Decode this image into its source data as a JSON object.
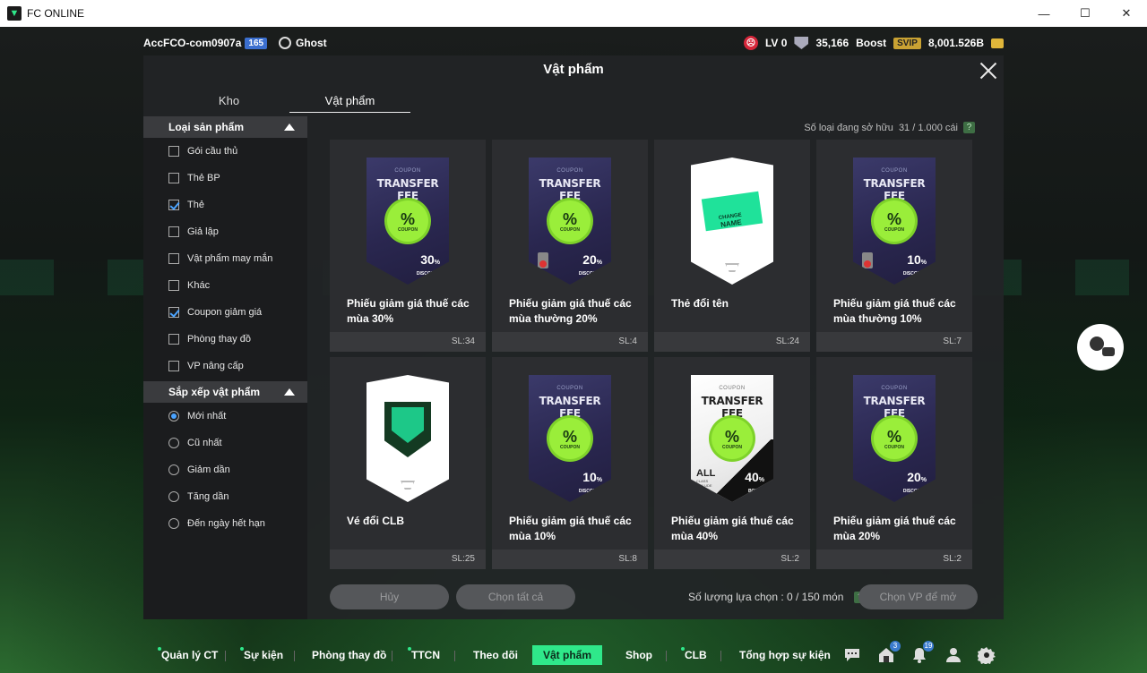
{
  "window": {
    "title": "FC ONLINE",
    "minimize": "—",
    "maximize": "☐",
    "close": "✕"
  },
  "topbar": {
    "account": "AccFCO-com0907a",
    "account_level": "165",
    "ghost": "Ghost",
    "lv": "LV 0",
    "points": "35,166",
    "boost": "Boost",
    "svip": "SVIP",
    "bp": "8,001.526B"
  },
  "modal": {
    "title": "Vật phẩm",
    "tabs": [
      {
        "label": "Kho"
      },
      {
        "label": "Vật phẩm"
      }
    ],
    "owned_label": "Số loại đang sở hữu",
    "owned_value": "31 / 1.000 cái",
    "help": "?"
  },
  "sidebar": {
    "category_title": "Loại sản phẩm",
    "categories": [
      {
        "label": "Gói cầu thủ",
        "checked": false
      },
      {
        "label": "Thẻ BP",
        "checked": false
      },
      {
        "label": "Thẻ",
        "checked": true
      },
      {
        "label": "Giả lập",
        "checked": false
      },
      {
        "label": "Vật phẩm may mắn",
        "checked": false
      },
      {
        "label": "Khác",
        "checked": false
      },
      {
        "label": "Coupon giảm giá",
        "checked": true
      },
      {
        "label": "Phòng thay đồ",
        "checked": false
      },
      {
        "label": "VP nâng cấp",
        "checked": false
      }
    ],
    "sort_title": "Sắp xếp vật phẩm",
    "sorts": [
      {
        "label": "Mới nhất",
        "selected": true
      },
      {
        "label": "Cũ nhất",
        "selected": false
      },
      {
        "label": "Giảm dần",
        "selected": false
      },
      {
        "label": "Tăng dần",
        "selected": false
      },
      {
        "label": "Đến ngày hết hạn",
        "selected": false
      }
    ]
  },
  "items": [
    {
      "name": "Phiếu giảm giá thuế các mùa 30%",
      "qty": "SL:34",
      "art": "coupon",
      "coupon_label": "COUPON",
      "fee": "TRANSFER FEE",
      "percent": "30",
      "pct_sign": "%",
      "discount": "DISCOUNT",
      "badge_sub": "COUPON"
    },
    {
      "name": "Phiếu giảm giá thuế các mùa thường 20%",
      "qty": "SL:4",
      "art": "coupon-no",
      "coupon_label": "COUPON",
      "fee": "TRANSFER FEE",
      "percent": "20",
      "pct_sign": "%",
      "discount": "DISCOUNT",
      "badge_sub": "COUPON"
    },
    {
      "name": "Thẻ đổi tên",
      "qty": "SL:24",
      "art": "name",
      "ticket_top": "CHANGE",
      "ticket_bottom": "NAME"
    },
    {
      "name": "Phiếu giảm giá thuế các mùa thường 10%",
      "qty": "SL:7",
      "art": "coupon-no",
      "coupon_label": "COUPON",
      "fee": "TRANSFER FEE",
      "percent": "10",
      "pct_sign": "%",
      "discount": "DISCOUNT",
      "badge_sub": "COUPON"
    },
    {
      "name": "Vé đổi CLB",
      "qty": "SL:25",
      "art": "club"
    },
    {
      "name": "Phiếu giảm giá thuế các mùa 10%",
      "qty": "SL:8",
      "art": "coupon",
      "coupon_label": "COUPON",
      "fee": "TRANSFER FEE",
      "percent": "10",
      "pct_sign": "%",
      "discount": "DISCOUNT",
      "badge_sub": "COUPON"
    },
    {
      "name": "Phiếu giảm giá thuế các mùa 40%",
      "qty": "SL:2",
      "art": "coupon-white",
      "coupon_label": "COUPON",
      "fee": "TRANSFER FEE",
      "percent": "40",
      "pct_sign": "%",
      "discount": "BONUS",
      "badge_sub": "COUPON",
      "all": "ALL",
      "all_sub": "CLASS INCLUDE"
    },
    {
      "name": "Phiếu giảm giá thuế các mùa 20%",
      "qty": "SL:2",
      "art": "coupon",
      "coupon_label": "COUPON",
      "fee": "TRANSFER FEE",
      "percent": "20",
      "pct_sign": "%",
      "discount": "DISCOUNT",
      "badge_sub": "COUPON"
    }
  ],
  "footer": {
    "cancel": "Hủy",
    "select_all": "Chọn tất cả",
    "selection_label": "Số lượng lựa chọn : 0 / 150 món",
    "help": "?",
    "choose_items": "Chọn VP để mở"
  },
  "bottom_nav": {
    "items": [
      {
        "label": "Quản lý CT",
        "dot": true
      },
      {
        "label": "Sự kiện",
        "dot": true
      },
      {
        "label": "Phòng thay đồ",
        "dot": false
      },
      {
        "label": "TTCN",
        "dot": true
      },
      {
        "label": "Theo dõi",
        "dot": false
      },
      {
        "label": "Vật phẩm",
        "dot": false,
        "active": true
      },
      {
        "label": "Shop",
        "dot": false
      },
      {
        "label": "CLB",
        "dot": true
      },
      {
        "label": "Tổng hợp sự kiện",
        "dot": false
      }
    ],
    "mail_count": "3",
    "notif_count": "19"
  },
  "colors": {
    "accent": "#2fe88a",
    "checkbox": "#4aa3ff",
    "coupon_green": "#9aee3a"
  }
}
